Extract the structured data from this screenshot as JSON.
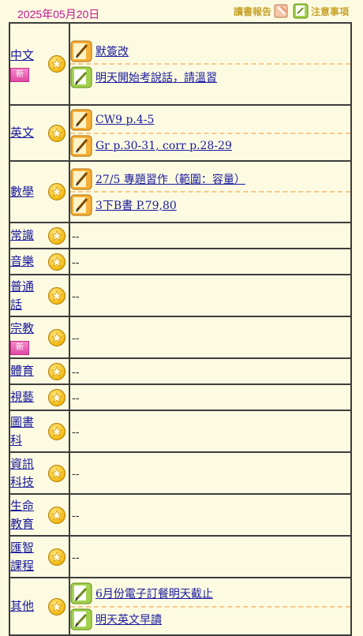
{
  "date": "2025年05月20日",
  "toplinks": {
    "reading": "讀書報告",
    "notices": "注意事項"
  },
  "rows": [
    {
      "subject": "中文",
      "is_new": true,
      "new_label": "新",
      "items": [
        {
          "text": "默簽改",
          "type": "pencil"
        },
        {
          "text": "明天開始考說話，請溫習",
          "type": "note"
        }
      ]
    },
    {
      "subject": "英文",
      "is_new": false,
      "items": [
        {
          "text": "CW9 p.4-5",
          "type": "pencil"
        },
        {
          "text": "Gr p.30-31, corr p.28-29",
          "type": "pencil"
        }
      ]
    },
    {
      "subject": "數學",
      "is_new": false,
      "items": [
        {
          "text": "27/5 專題習作（範圍：容量）",
          "type": "pencil"
        },
        {
          "text": "3下B書 P.79,80",
          "type": "pencil"
        }
      ]
    },
    {
      "subject": "常識",
      "is_new": false,
      "items": [],
      "empty": "--"
    },
    {
      "subject": "音樂",
      "is_new": false,
      "items": [],
      "empty": "--"
    },
    {
      "subject": "普通話",
      "is_new": false,
      "items": [],
      "empty": "--"
    },
    {
      "subject": "宗教",
      "is_new": true,
      "new_label": "新",
      "items": [],
      "empty": "--"
    },
    {
      "subject": "體育",
      "is_new": false,
      "items": [],
      "empty": "--"
    },
    {
      "subject": "視藝",
      "is_new": false,
      "items": [],
      "empty": "--"
    },
    {
      "subject": "圖書科",
      "is_new": false,
      "items": [],
      "empty": "--"
    },
    {
      "subject": "資訊科技",
      "is_new": false,
      "items": [],
      "empty": "--"
    },
    {
      "subject": "生命教育",
      "is_new": false,
      "items": [],
      "empty": "--"
    },
    {
      "subject": "匯智課程",
      "is_new": false,
      "items": [],
      "empty": "--"
    },
    {
      "subject": "其他",
      "is_new": false,
      "items": [
        {
          "text": "6月份電子訂餐明天截止",
          "type": "note"
        },
        {
          "text": "明天英文早讀",
          "type": "note"
        }
      ]
    }
  ]
}
